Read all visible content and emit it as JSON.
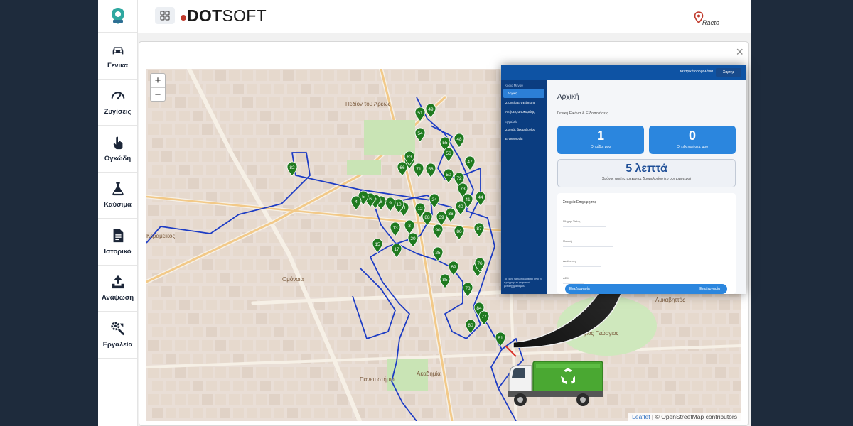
{
  "sidebar": {
    "items": [
      {
        "label": "Γενικα",
        "icon": "car-icon"
      },
      {
        "label": "Ζυγίσεις",
        "icon": "gauge-icon"
      },
      {
        "label": "Ογκώδη",
        "icon": "hand-pointer-icon"
      },
      {
        "label": "Καύσιμα",
        "icon": "flask-icon"
      },
      {
        "label": "Ιστορικό",
        "icon": "document-icon"
      },
      {
        "label": "Ανάψωση",
        "icon": "upload-icon"
      },
      {
        "label": "Εργαλεία",
        "icon": "tools-icon"
      }
    ]
  },
  "header": {
    "brand_bold": "DOT",
    "brand_light": "SOFT",
    "partner_logo": "Raeto"
  },
  "map": {
    "attribution_leaflet": "Leaflet",
    "attribution_rest": " | © OpenStreetMap contributors",
    "zoom_in": "+",
    "zoom_out": "−",
    "labels": [
      {
        "text": "Ομόνοια"
      },
      {
        "text": "Πανεπιστήμιο"
      },
      {
        "text": "Ακαδημία"
      },
      {
        "text": "Άγιος Γεώργιος"
      },
      {
        "text": "Λυκαβηττός"
      },
      {
        "text": "Κεραμεικός"
      },
      {
        "text": "Πεδίον του Άρεως"
      }
    ],
    "markers": [
      "49",
      "51",
      "54",
      "48",
      "55",
      "56",
      "65",
      "66",
      "71",
      "58",
      "50",
      "47",
      "72",
      "73",
      "44",
      "41",
      "40",
      "36",
      "39",
      "12",
      "11",
      "10",
      "9",
      "8",
      "7",
      "6",
      "5",
      "4",
      "3",
      "13",
      "15",
      "17",
      "20",
      "24",
      "25",
      "69",
      "74",
      "76",
      "78",
      "84",
      "77",
      "80",
      "81",
      "82",
      "83",
      "90",
      "85",
      "86",
      "87",
      "88"
    ]
  },
  "inset": {
    "topbar_label": "Κεντρικά Δρομολόγια",
    "topbar_button": "Χάρτης",
    "menu_header": "Κύριο Μενού",
    "menu_items": [
      "Αρχική",
      "Στοιχεία Επιχείρησης",
      "Αιτήσεις αποκομιδής"
    ],
    "menu_section": "Εργαλεία",
    "menu_items2": [
      "Σκοπός δρομολογίου",
      "Επικοινωνία"
    ],
    "sidebar_note": "Το έργο χρηματοδοτείται από το πρόγραμμα ψηφιακού μετασχηματισμού",
    "title": "Αρχική",
    "subtitle": "Γενική Εικόνα & Ειδοποιήσεις",
    "card1_value": "1",
    "card1_caption": "Οι κάδοι μου",
    "card2_value": "0",
    "card2_caption": "Οι ειδοποιήσεις μου",
    "time_value": "5 λεπτά",
    "time_caption": "Χρόνος άφιξης τρέχοντος δρομολογίου (το συντομότερο)",
    "details_header": "Στοιχεία Επιχείρησης",
    "detail_labels": [
      "Πλήρης Τίτλος",
      "Μορφή",
      "Διεύθυνση",
      "ΑΦΜ"
    ],
    "bottom_button_left": "Επεξεργασία",
    "bottom_button_right": "Επεξεργασία"
  },
  "colors": {
    "background": "#1e2b3c",
    "route": "#1d3cc4",
    "marker": "#1f7a1f",
    "accent_blue": "#2b86de",
    "truck_green": "#4aa832"
  }
}
